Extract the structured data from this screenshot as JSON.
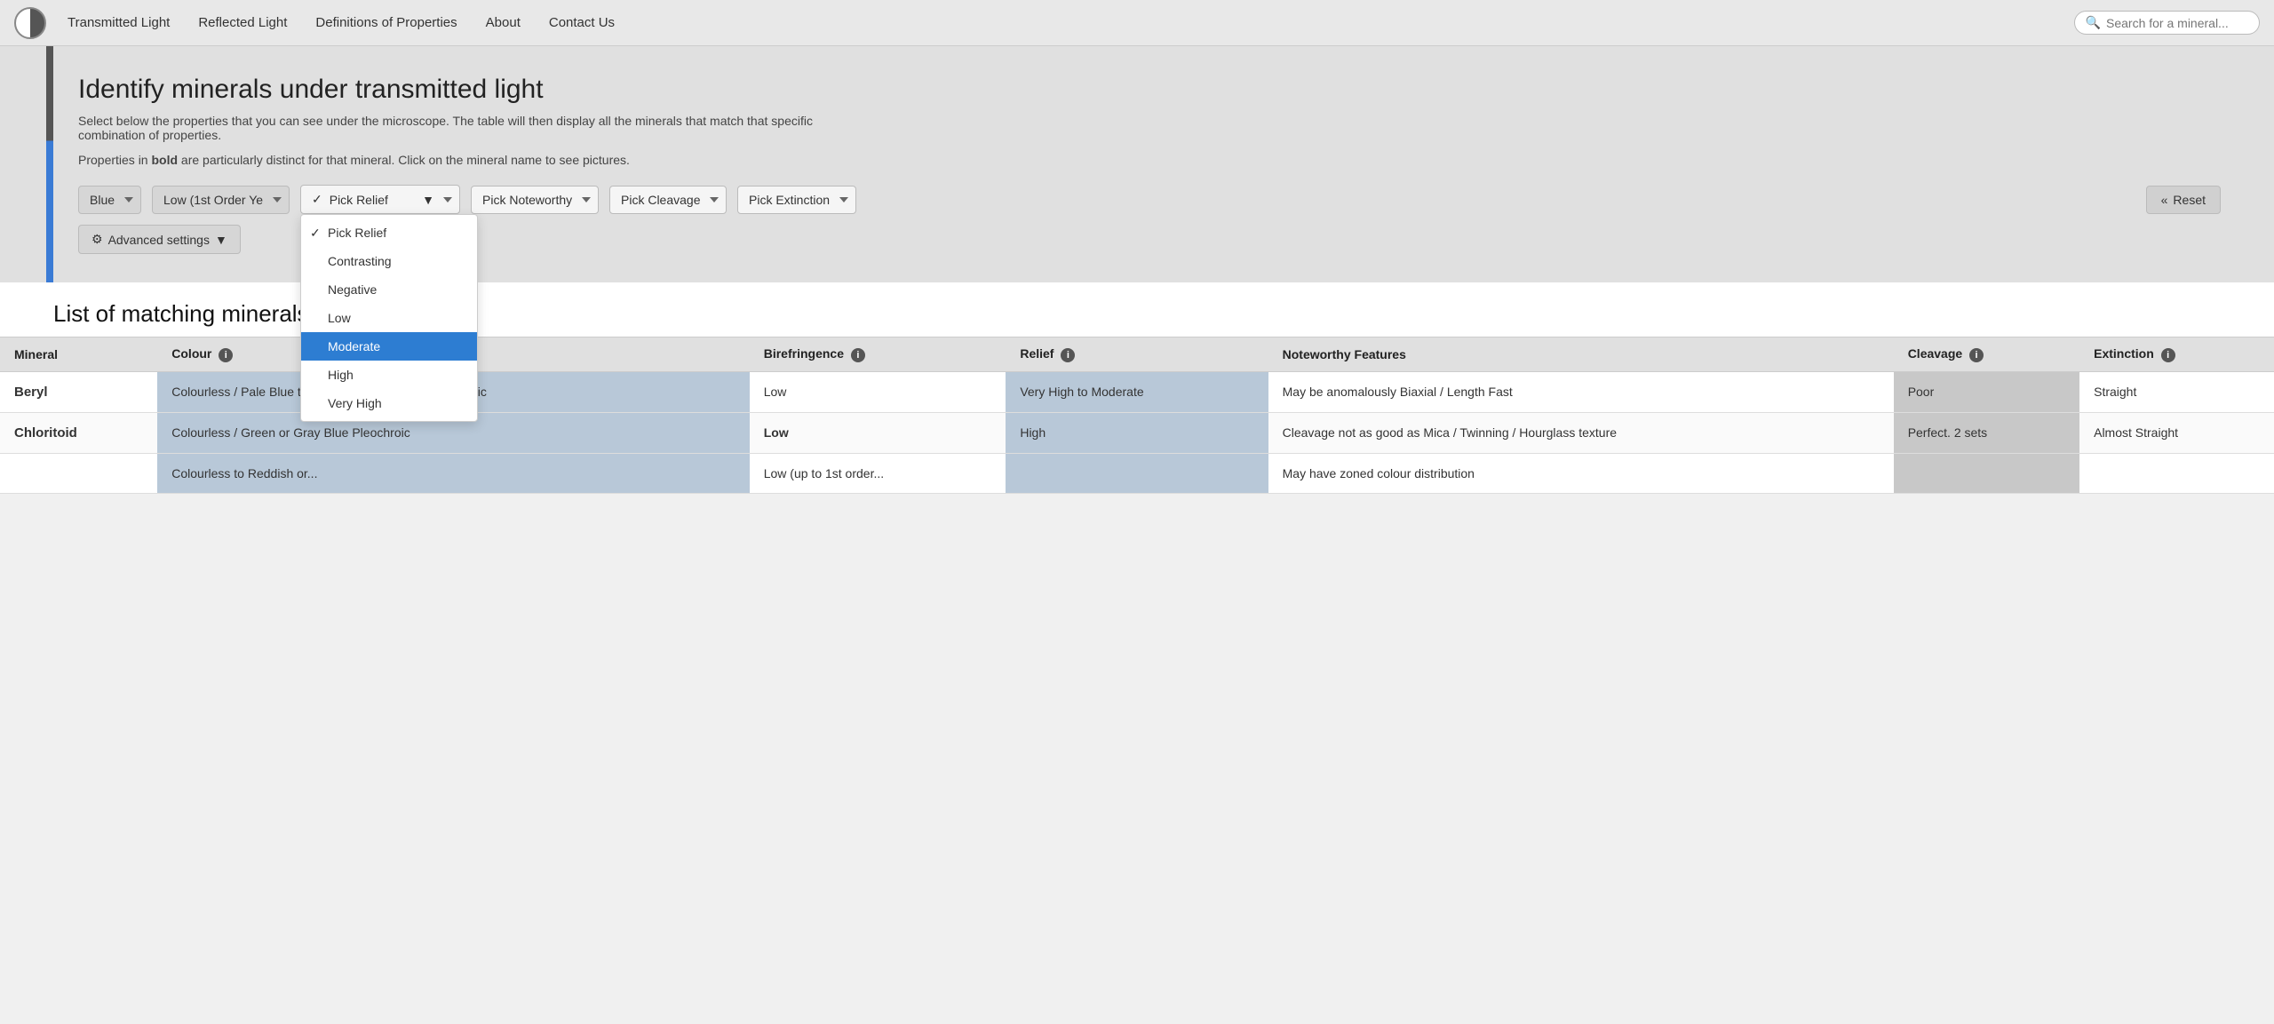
{
  "nav": {
    "links": [
      {
        "label": "Transmitted Light",
        "id": "nav-transmitted"
      },
      {
        "label": "Reflected Light",
        "id": "nav-reflected"
      },
      {
        "label": "Definitions of Properties",
        "id": "nav-definitions"
      },
      {
        "label": "About",
        "id": "nav-about"
      },
      {
        "label": "Contact Us",
        "id": "nav-contact"
      }
    ],
    "search_placeholder": "Search for a mineral..."
  },
  "hero": {
    "title": "Identify minerals under transmitted light",
    "subtitle": "Select below the properties that you can see under the microscope. The table will then display all the minerals that match that specific combination of properties.",
    "bold_note_prefix": "Properties in ",
    "bold_word": "bold",
    "bold_note_suffix": " are particularly distinct for that mineral. Click on the mineral name to see pictures."
  },
  "filters": {
    "colour_value": "Blue",
    "birefringence_value": "Low (1st Order Ye",
    "relief_placeholder": "Pick Relief",
    "relief_options": [
      {
        "label": "Pick Relief",
        "checked": true,
        "selected": false
      },
      {
        "label": "Contrasting",
        "checked": false,
        "selected": false
      },
      {
        "label": "Negative",
        "checked": false,
        "selected": false
      },
      {
        "label": "Low",
        "checked": false,
        "selected": false
      },
      {
        "label": "Moderate",
        "checked": false,
        "selected": true
      },
      {
        "label": "High",
        "checked": false,
        "selected": false
      },
      {
        "label": "Very High",
        "checked": false,
        "selected": false
      }
    ],
    "noteworthy_placeholder": "Pick Noteworthy",
    "cleavage_placeholder": "Pick Cleavage",
    "extinction_placeholder": "Pick Extinction",
    "advanced_label": "Advanced settings",
    "reset_label": "Reset"
  },
  "results": {
    "heading": "List of matching minerals – 8 matches",
    "columns": [
      {
        "label": "Mineral",
        "info": false
      },
      {
        "label": "Colour",
        "info": true
      },
      {
        "label": "Birefringence",
        "info": true
      },
      {
        "label": "Relief",
        "info": true
      },
      {
        "label": "Noteworthy Features",
        "info": false
      },
      {
        "label": "Cleavage",
        "info": true
      },
      {
        "label": "Extinction",
        "info": true
      }
    ],
    "rows": [
      {
        "mineral": "Beryl",
        "colour": "Colourless / Pale Blue to Pale Green / Weakly Pleochroic",
        "birefringence": "Low",
        "relief": "Very High to Moderate",
        "noteworthy": "May be anomalously Biaxial / Length Fast",
        "cleavage": "Poor",
        "extinction": "Straight"
      },
      {
        "mineral": "Chloritoid",
        "colour": "Colourless / Green or Gray Blue Pleochroic",
        "birefringence_bold": "Low",
        "relief": "High",
        "noteworthy": "Cleavage not as good as Mica / Twinning / Hourglass texture",
        "cleavage": "Perfect. 2 sets",
        "extinction": "Almost Straight"
      },
      {
        "mineral": "",
        "colour": "Colourless to Reddish or...",
        "birefringence": "Low (up to 1st order...",
        "relief": "",
        "noteworthy": "May have zoned colour distribution",
        "cleavage": "",
        "extinction": ""
      }
    ]
  }
}
